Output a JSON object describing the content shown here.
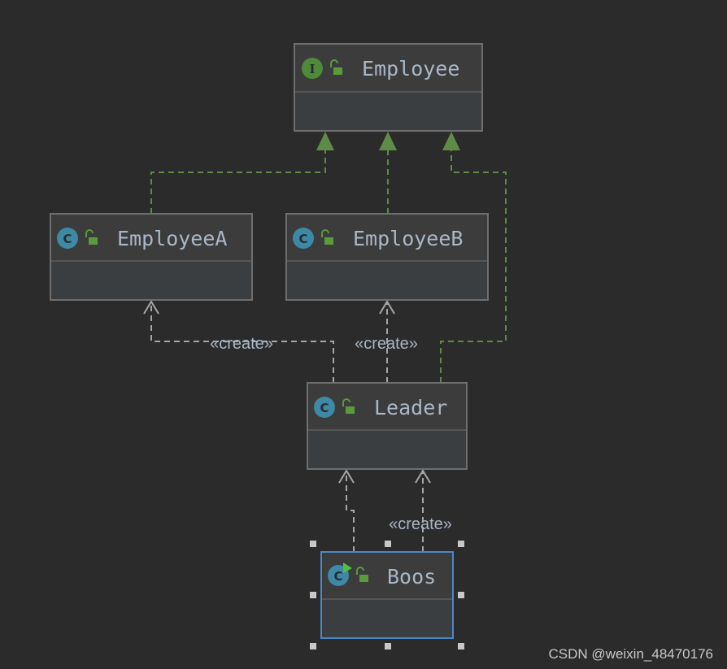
{
  "nodes": [
    {
      "id": "employee",
      "name": "Employee",
      "kind": "interface",
      "icon": "interface-icon",
      "letter": "I"
    },
    {
      "id": "employeeA",
      "name": "EmployeeA",
      "kind": "class",
      "icon": "class-icon",
      "letter": "C"
    },
    {
      "id": "employeeB",
      "name": "EmployeeB",
      "kind": "class",
      "icon": "class-icon",
      "letter": "C"
    },
    {
      "id": "leader",
      "name": "Leader",
      "kind": "class",
      "icon": "class-icon",
      "letter": "C"
    },
    {
      "id": "boos",
      "name": "Boos",
      "kind": "main-class",
      "icon": "runnable-class-icon",
      "letter": "C",
      "selected": true
    }
  ],
  "edges": [
    {
      "from": "employeeA",
      "to": "employee",
      "type": "realization"
    },
    {
      "from": "employeeB",
      "to": "employee",
      "type": "realization"
    },
    {
      "from": "leader",
      "to": "employee",
      "type": "realization"
    },
    {
      "from": "leader",
      "to": "employeeA",
      "type": "dependency",
      "label": "«create»"
    },
    {
      "from": "leader",
      "to": "employeeB",
      "type": "dependency",
      "label": "«create»"
    },
    {
      "from": "boos",
      "to": "leader",
      "type": "dependency",
      "label": ""
    },
    {
      "from": "boos",
      "to": "leader",
      "type": "dependency",
      "label": "«create»"
    }
  ],
  "watermark": "CSDN @weixin_48470176",
  "colors": {
    "background": "#2b2b2b",
    "realization": "#5e8c47",
    "dependency": "#a6a6a6",
    "selection": "#4a88c7",
    "text": "#a9b7c6",
    "class_icon": "#3d89a6",
    "interface_icon": "#4e8a3a"
  }
}
